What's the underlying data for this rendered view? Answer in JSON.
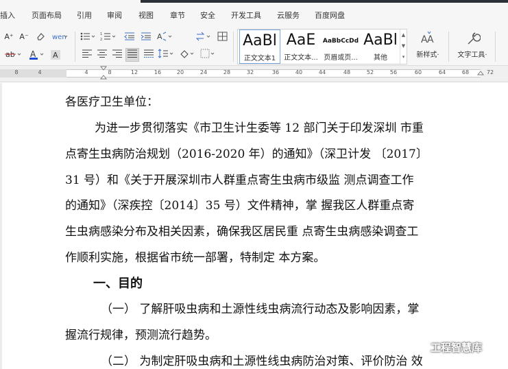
{
  "menu": {
    "items": [
      "插入",
      "页面布局",
      "引用",
      "审阅",
      "视图",
      "章节",
      "安全",
      "开发工具",
      "云服务",
      "百度网盘"
    ]
  },
  "ribbon": {
    "font_grow": "A⁺",
    "font_shrink": "A⁻",
    "eraser": "⌫",
    "pinyin": "ᵂ",
    "styles": [
      {
        "sample": "AaBl",
        "name": "正文文本1"
      },
      {
        "sample": "AaE",
        "name": "正文文本..."
      },
      {
        "sample": "AaBbCcDd",
        "name": "页眉或页..."
      },
      {
        "sample": "AaBl",
        "name": "其他"
      }
    ],
    "new_style_label": "新样式·",
    "text_tools_label": "文字工具·"
  },
  "ruler": {
    "left_numbers": [
      "8",
      "4"
    ],
    "numbers": [
      "4",
      "8",
      "12",
      "16",
      "20",
      "24",
      "28",
      "32",
      "36",
      "40",
      "44",
      "48",
      "52",
      "56",
      "60",
      "64",
      "68",
      "72"
    ]
  },
  "document": {
    "lines": [
      "各医疗卫生单位：",
      "为进一步贯彻落实《市卫生计生委等 12 部门关于印发深圳 市重",
      "点寄生虫病防治规划（2016-2020 年）的通知》（深卫计发 〔2017〕",
      "31 号）和《关于开展深圳市人群重点寄生虫病市级监 测点调查工作",
      "的通知》（深疾控〔2014〕35 号）文件精神，掌 握我区人群重点寄",
      "生虫病感染分布及相关因素，确保我区居民重 点寄生虫病感染调查工",
      "作顺利实施，根据省市统一部署，特制定 本方案。"
    ],
    "heading1": "一、目的",
    "item1_line1": "（一）  了解肝吸虫病和土源性线虫病流行动态及影响因素，掌",
    "item1_line2": "握流行规律，预测流行趋势。",
    "item2_line1": "（二）  为制定肝吸虫病和土源性线虫病防治对策、评价防治 效"
  },
  "watermark": {
    "text": "工程智慧库"
  }
}
